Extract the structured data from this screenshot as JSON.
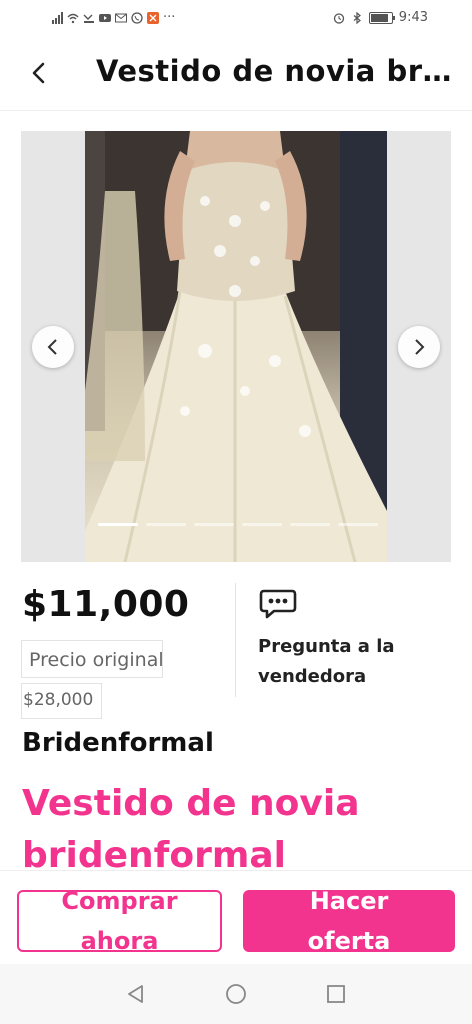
{
  "status_bar": {
    "time": "9:43",
    "notification_icons": [
      "signal-icon",
      "wifi-icon",
      "missed-call-icon",
      "youtube-icon",
      "gmail-icon",
      "whatsapp-icon",
      "app-icon",
      "more-icon"
    ],
    "more": "···",
    "battery_level": 0.85
  },
  "header": {
    "back_icon": "chevron-left-icon",
    "title": "Vestido de novia bridenformal"
  },
  "gallery": {
    "total_images": 6,
    "active_index": 0
  },
  "product": {
    "price": "$11,000",
    "original_price_label": "Precio original",
    "original_price": "$28,000",
    "ask_seller_line1": "Pregunta a la",
    "ask_seller_line2": "vendedora",
    "seller": "Bridenformal",
    "title_line1": "Vestido de novia",
    "title_line2": "bridenformal"
  },
  "actions": {
    "buy_line1": "Comprar",
    "buy_line2": "ahora",
    "offer_line1": "Hacer",
    "offer_line2": "oferta"
  },
  "colors": {
    "accent": "#f2348f"
  }
}
